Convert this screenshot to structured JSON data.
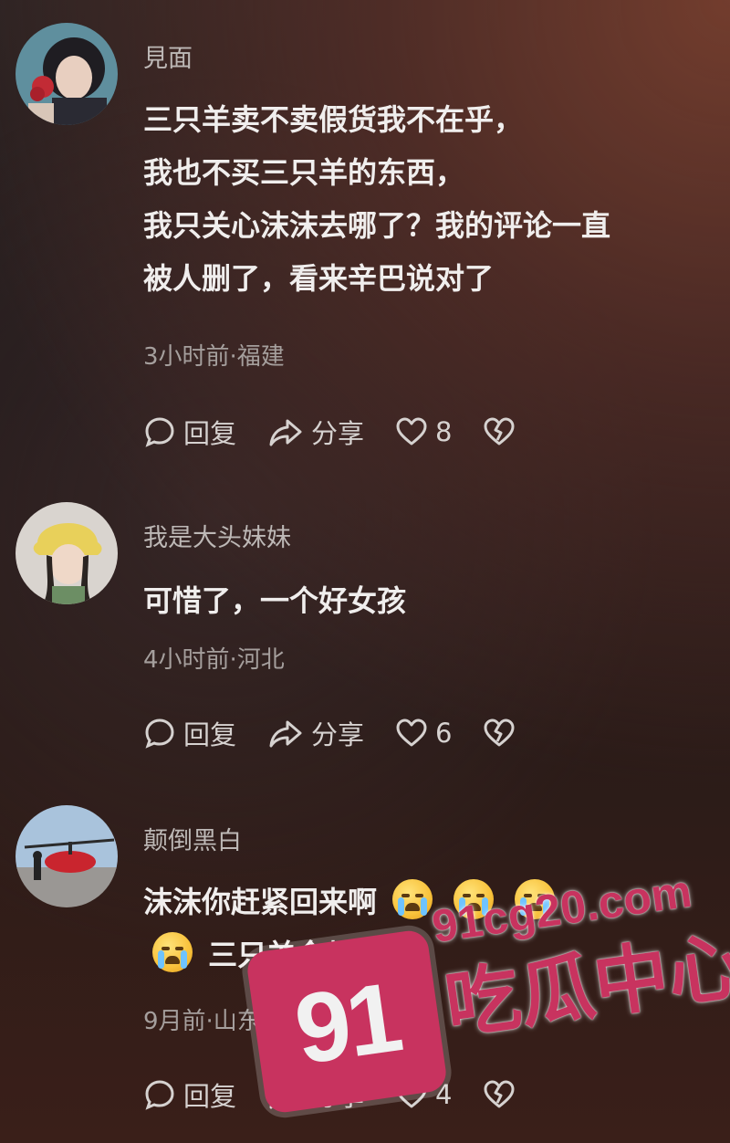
{
  "comments": [
    {
      "username": "見面",
      "lines": [
        "三只羊卖不卖假货我不在乎，",
        "我也不买三只羊的东西，",
        "我只关心沫沫去哪了？我的评论一直",
        "被人删了，看来辛巴说对了"
      ],
      "meta": "3小时前·福建",
      "reply_label": "回复",
      "share_label": "分享",
      "likes": "8"
    },
    {
      "username": "我是大头妹妹",
      "lines": [
        "可惜了，一个好女孩"
      ],
      "meta": "4小时前·河北",
      "reply_label": "回复",
      "share_label": "分享",
      "likes": "6"
    },
    {
      "username": "颠倒黑白",
      "line1": "沫沫你赶紧回来啊",
      "line2": "三只羊全都开播",
      "meta": "9月前·山东",
      "reply_label": "回复",
      "share_label": "分享",
      "likes": "4"
    }
  ],
  "icons": {
    "reply": "speech-bubble-icon",
    "share": "share-arrow-icon",
    "like": "heart-icon",
    "dislike": "broken-heart-icon",
    "emoji": "loudly-crying-face-emoji"
  },
  "watermark": {
    "badge": "91",
    "site": "91cg20.com",
    "name": "吃瓜中心"
  }
}
